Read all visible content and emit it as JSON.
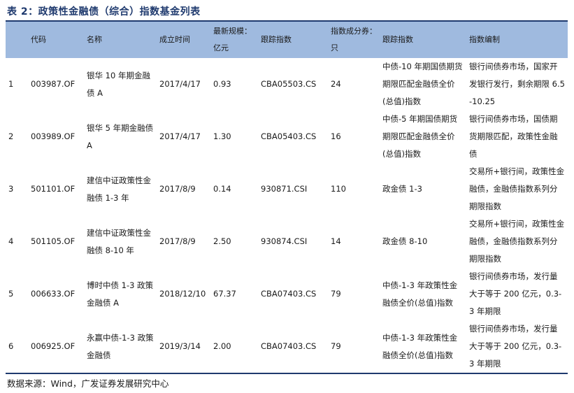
{
  "caption": "表 2：政策性金融债（综合）指数基金列表",
  "header": {
    "code": "代码",
    "name": "名称",
    "date": "成立时间",
    "size": "最新规模：亿元",
    "index": "跟踪指数",
    "count": "指数成分券：只",
    "index_name": "跟踪指数",
    "compile": "指数编制"
  },
  "rows": [
    {
      "no": "1",
      "code": "003987.OF",
      "name": "银华 10 年期金融债 A",
      "date": "2017/4/17",
      "size": "0.93",
      "index": "CBA05503.CS",
      "count": "24",
      "index_name": "中债-10 年期国债期货期限匹配金融债全价(总值)指数",
      "compile": "银行间债券市场，国家开发银行发行，剩余期限 6.5-10.25"
    },
    {
      "no": "2",
      "code": "003989.OF",
      "name": "银华 5 年期金融债 A",
      "date": "2017/4/17",
      "size": "1.30",
      "index": "CBA05403.CS",
      "count": "16",
      "index_name": "中债-5 年期国债期货期限匹配金融债全价(总值)指数",
      "compile": "银行间债券市场，国债期货期限匹配，政策性金融债"
    },
    {
      "no": "3",
      "code": "501101.OF",
      "name": "建信中证政策性金融债 1-3 年",
      "date": "2017/8/9",
      "size": "0.14",
      "index": "930871.CSI",
      "count": "110",
      "index_name": "政金债 1-3",
      "compile": "交易所+银行间，政策性金融债，金融债指数系列分期限指数"
    },
    {
      "no": "4",
      "code": "501105.OF",
      "name": "建信中证政策性金融债 8-10 年",
      "date": "2017/8/9",
      "size": "2.50",
      "index": "930874.CSI",
      "count": "14",
      "index_name": "政金债 8-10",
      "compile": "交易所+银行间，政策性金融债，金融债指数系列分期限指数"
    },
    {
      "no": "5",
      "code": "006633.OF",
      "name": "博时中债 1-3 政策金融债 A",
      "date": "2018/12/10",
      "size": "67.37",
      "index": "CBA07403.CS",
      "count": "79",
      "index_name": "中债-1-3 年政策性金融债全价(总值)指数",
      "compile": "银行间债券市场，发行量大于等于 200 亿元，0.3-3 年期限"
    },
    {
      "no": "6",
      "code": "006925.OF",
      "name": "永赢中债-1-3 政策金融债",
      "date": "2019/3/14",
      "size": "2.00",
      "index": "CBA07403.CS",
      "count": "79",
      "index_name": "中债-1-3 年政策性金融债全价(总值)指数",
      "compile": "银行间债券市场，发行量大于等于 200 亿元，0.3-3 年期限"
    }
  ],
  "source": "数据来源：Wind，广发证券发展研究中心"
}
